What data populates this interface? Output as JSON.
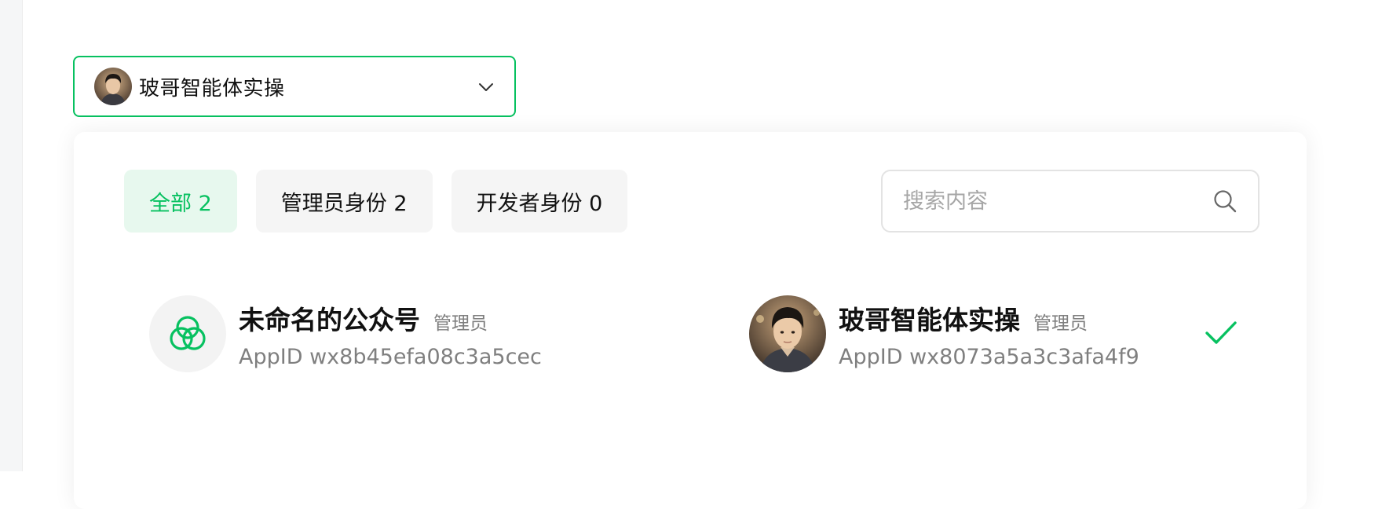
{
  "selector": {
    "current_account": "玻哥智能体实操",
    "avatar_icon": "person-photo-avatar",
    "chevron_icon": "chevron-down-icon"
  },
  "tabs": [
    {
      "label": "全部 2",
      "active": true
    },
    {
      "label": "管理员身份 2",
      "active": false
    },
    {
      "label": "开发者身份 0",
      "active": false
    }
  ],
  "search": {
    "placeholder": "搜索内容",
    "value": "",
    "icon": "search-icon"
  },
  "accounts": [
    {
      "name": "未命名的公众号",
      "role": "管理员",
      "appid": "AppID wx8b45efa08c3a5cec",
      "avatar_icon": "default-account-logo-icon",
      "selected": false
    },
    {
      "name": "玻哥智能体实操",
      "role": "管理员",
      "appid": "AppID wx8073a5a3c3afa4f9",
      "avatar_icon": "person-photo-avatar",
      "selected": true
    }
  ],
  "colors": {
    "accent": "#07c160",
    "accent_light": "#e7f8ee",
    "text": "#111111",
    "muted": "#7f7f7f",
    "tab_bg": "#f5f5f5"
  }
}
